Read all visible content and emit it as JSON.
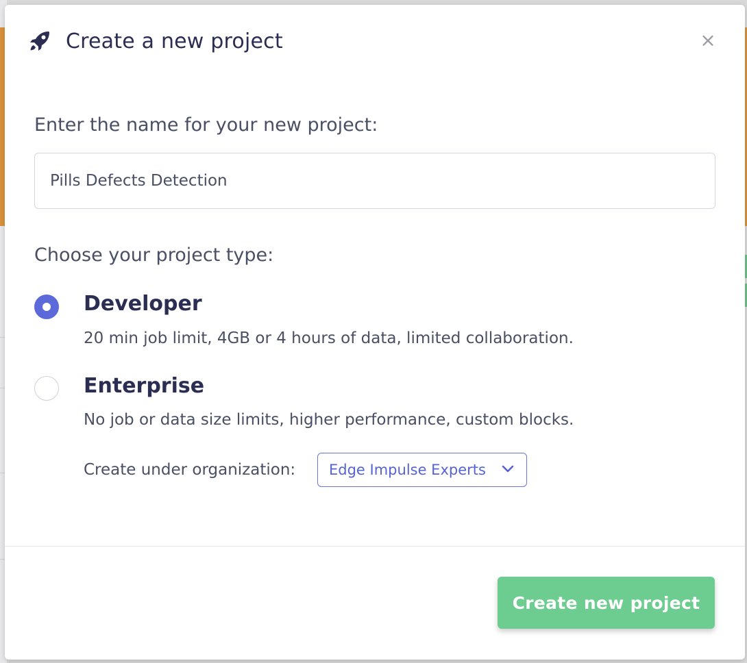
{
  "modal": {
    "title": "Create a new project",
    "title_icon": "rocket-icon",
    "close_icon": "close-icon",
    "close_glyph": "×"
  },
  "name_section": {
    "label": "Enter the name for your new project:",
    "input_value": "Pills Defects Detection"
  },
  "type_section": {
    "label": "Choose your project type:",
    "options": [
      {
        "title": "Developer",
        "description": "20 min job limit, 4GB or 4 hours of data, limited collaboration.",
        "selected": true
      },
      {
        "title": "Enterprise",
        "description": "No job or data size limits, higher performance, custom blocks.",
        "selected": false
      }
    ],
    "organization": {
      "label": "Create under organization:",
      "selected": "Edge Impulse Experts",
      "icon": "chevron-down-icon"
    }
  },
  "footer": {
    "create_label": "Create new project"
  },
  "colors": {
    "accent": "#5b6ad8",
    "create_button": "#6dcc8f",
    "title_text": "#2b2d52",
    "body_text": "#4a4f63"
  }
}
